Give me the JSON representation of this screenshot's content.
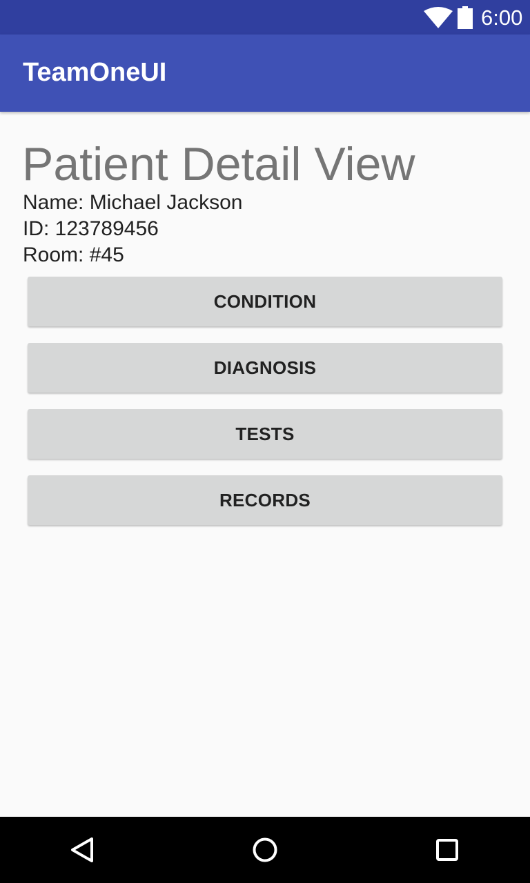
{
  "status_bar": {
    "time": "6:00",
    "icons": [
      "wifi-icon",
      "battery-icon"
    ]
  },
  "app_bar": {
    "title": "TeamOneUI",
    "color": "#3f51b5",
    "status_color": "#303f9f"
  },
  "page": {
    "title": "Patient Detail View",
    "patient": {
      "name_line": "Name: Michael Jackson",
      "id_line": "ID: 123789456",
      "room_line": "Room: #45"
    },
    "buttons": [
      {
        "label": "CONDITION"
      },
      {
        "label": "DIAGNOSIS"
      },
      {
        "label": "TESTS"
      },
      {
        "label": "RECORDS"
      }
    ]
  },
  "nav_bar": {
    "items": [
      "back-icon",
      "home-icon",
      "recents-icon"
    ]
  }
}
